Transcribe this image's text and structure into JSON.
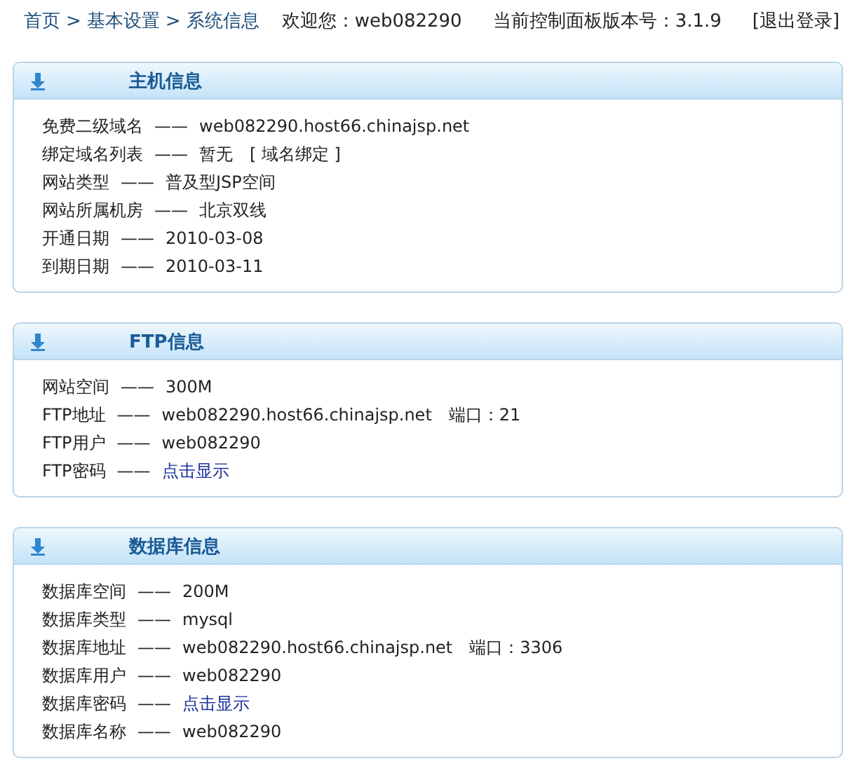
{
  "breadcrumb": {
    "items": [
      "首页",
      "基本设置",
      "系统信息"
    ],
    "separator": ">"
  },
  "welcome": {
    "label": "欢迎您：",
    "user": "web082290"
  },
  "version": {
    "label": "当前控制面板版本号：",
    "value": "3.1.9"
  },
  "logout": "[退出登录]",
  "panels": [
    {
      "title": "主机信息",
      "rows": [
        {
          "label": "免费二级域名",
          "dash": "——",
          "value": "web082290.host66.chinajsp.net",
          "kind": "text"
        },
        {
          "label": "绑定域名列表",
          "dash": "——",
          "value": "暂无",
          "kind": "text",
          "extra": "[ 域名绑定 ]"
        },
        {
          "label": "网站类型",
          "dash": "——",
          "value": "普及型JSP空间",
          "kind": "text"
        },
        {
          "label": "网站所属机房",
          "dash": "——",
          "value": "北京双线",
          "kind": "text"
        },
        {
          "label": "开通日期",
          "dash": "——",
          "value": "2010-03-08",
          "kind": "text"
        },
        {
          "label": "到期日期",
          "dash": "——",
          "value": "2010-03-11",
          "kind": "text"
        }
      ]
    },
    {
      "title": "FTP信息",
      "rows": [
        {
          "label": "网站空间",
          "dash": "——",
          "value": "300M",
          "kind": "text"
        },
        {
          "label": "FTP地址",
          "dash": "——",
          "value": "web082290.host66.chinajsp.net",
          "kind": "text",
          "extra": "端口：21"
        },
        {
          "label": "FTP用户",
          "dash": "——",
          "value": "web082290",
          "kind": "text"
        },
        {
          "label": "FTP密码",
          "dash": "——",
          "value": "点击显示",
          "kind": "link"
        }
      ]
    },
    {
      "title": "数据库信息",
      "rows": [
        {
          "label": "数据库空间",
          "dash": "——",
          "value": "200M",
          "kind": "text"
        },
        {
          "label": "数据库类型",
          "dash": "——",
          "value": "mysql",
          "kind": "text"
        },
        {
          "label": "数据库地址",
          "dash": "——",
          "value": "web082290.host66.chinajsp.net",
          "kind": "text",
          "extra": "端口：3306"
        },
        {
          "label": "数据库用户",
          "dash": "——",
          "value": "web082290",
          "kind": "text"
        },
        {
          "label": "数据库密码",
          "dash": "——",
          "value": "点击显示",
          "kind": "link"
        },
        {
          "label": "数据库名称",
          "dash": "——",
          "value": "web082290",
          "kind": "text"
        }
      ]
    }
  ]
}
